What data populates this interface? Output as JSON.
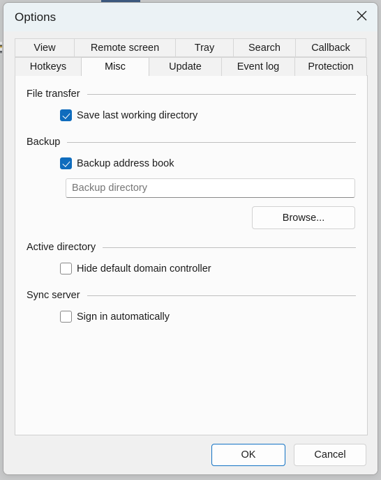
{
  "window": {
    "title": "Options",
    "close_icon": "close-icon"
  },
  "tabs": {
    "row1": [
      {
        "label": "View",
        "selected": false
      },
      {
        "label": "Remote screen",
        "selected": false
      },
      {
        "label": "Tray",
        "selected": false
      },
      {
        "label": "Search",
        "selected": false
      },
      {
        "label": "Callback",
        "selected": false
      }
    ],
    "row2": [
      {
        "label": "Hotkeys",
        "selected": false
      },
      {
        "label": "Misc",
        "selected": true
      },
      {
        "label": "Update",
        "selected": false
      },
      {
        "label": "Event log",
        "selected": false
      },
      {
        "label": "Protection",
        "selected": false
      }
    ],
    "active": "Misc"
  },
  "groups": {
    "file_transfer": {
      "title": "File transfer",
      "save_last_working_directory": {
        "label": "Save last working directory",
        "checked": true
      }
    },
    "backup": {
      "title": "Backup",
      "backup_address_book": {
        "label": "Backup address book",
        "checked": true
      },
      "directory_input": {
        "value": "",
        "placeholder": "Backup directory"
      },
      "browse_label": "Browse..."
    },
    "active_directory": {
      "title": "Active directory",
      "hide_default_domain_controller": {
        "label": "Hide default domain controller",
        "checked": false
      }
    },
    "sync_server": {
      "title": "Sync server",
      "sign_in_automatically": {
        "label": "Sign in automatically",
        "checked": false
      }
    }
  },
  "footer": {
    "ok_label": "OK",
    "cancel_label": "Cancel"
  },
  "colors": {
    "accent": "#0f6cbd",
    "default_button_border": "#1272c4",
    "title_bar_bg": "#ebf2f5",
    "dialog_bg": "#f0f0f0",
    "panel_bg": "#fbfbfb"
  }
}
